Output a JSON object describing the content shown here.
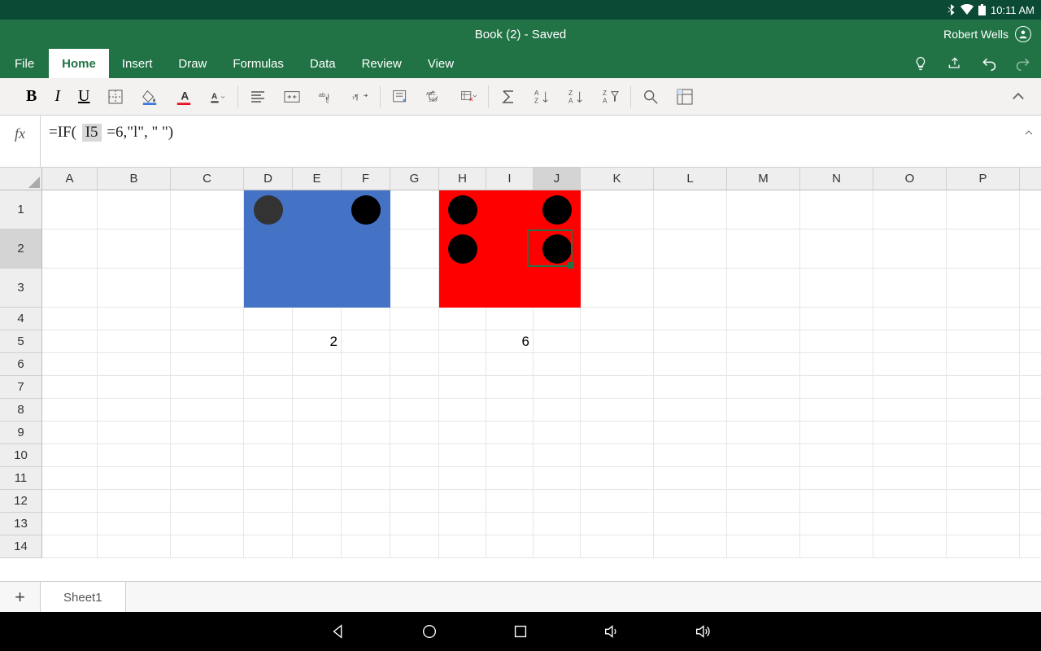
{
  "status": {
    "time": "10:11 AM"
  },
  "title": "Book (2)  -  Saved",
  "user": "Robert Wells",
  "tabs": {
    "file": "File",
    "home": "Home",
    "insert": "Insert",
    "draw": "Draw",
    "formulas": "Formulas",
    "data": "Data",
    "review": "Review",
    "view": "View"
  },
  "formula": {
    "prefix": "=IF(",
    "ref": "I5",
    "suffix": " =6,\"l\", \" \")"
  },
  "columns": [
    "A",
    "B",
    "C",
    "D",
    "E",
    "F",
    "G",
    "H",
    "I",
    "J",
    "K",
    "L",
    "M",
    "N",
    "O",
    "P",
    ""
  ],
  "rows": [
    "1",
    "2",
    "3",
    "4",
    "5",
    "6",
    "7",
    "8",
    "9",
    "10",
    "11",
    "12",
    "13",
    "14"
  ],
  "values": {
    "E5": "2",
    "I5": "6"
  },
  "sheet": "Sheet1"
}
